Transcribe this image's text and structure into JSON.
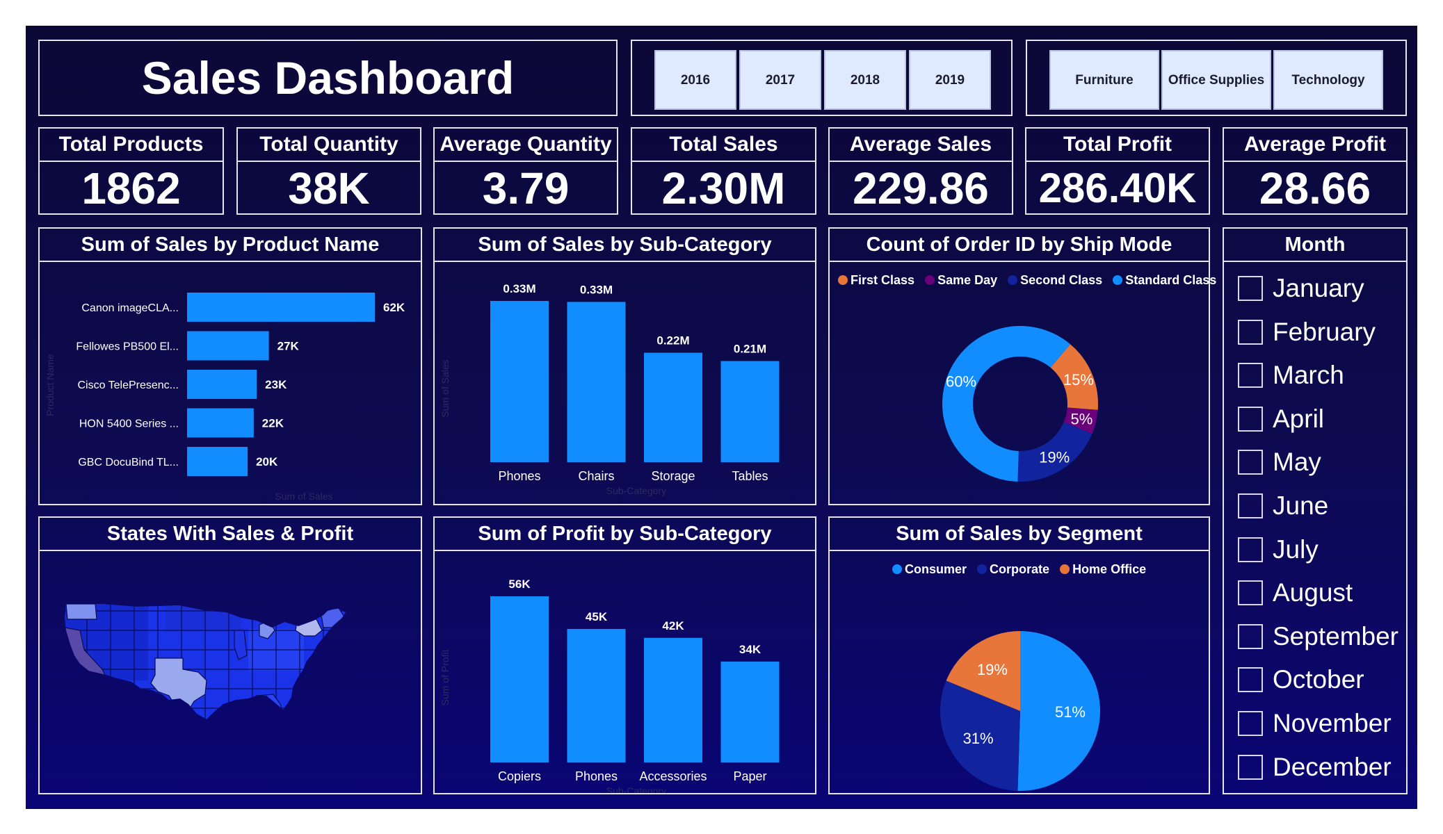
{
  "title": "Sales Dashboard",
  "year_slicer": [
    "2016",
    "2017",
    "2018",
    "2019"
  ],
  "category_slicer": [
    "Furniture",
    "Office Supplies",
    "Technology"
  ],
  "kpis": [
    {
      "label": "Total Products",
      "value": "1862"
    },
    {
      "label": "Total Quantity",
      "value": "38K"
    },
    {
      "label": "Average Quantity",
      "value": "3.79"
    },
    {
      "label": "Total Sales",
      "value": "2.30M"
    },
    {
      "label": "Average Sales",
      "value": "229.86"
    },
    {
      "label": "Total Profit",
      "value": "286.40K"
    },
    {
      "label": "Average Profit",
      "value": "28.66"
    }
  ],
  "month_slicer": {
    "title": "Month",
    "months": [
      "January",
      "February",
      "March",
      "April",
      "May",
      "June",
      "July",
      "August",
      "September",
      "October",
      "November",
      "December"
    ]
  },
  "map_panel": {
    "title": "States With Sales & Profit"
  },
  "colors": {
    "bar": "#118dff",
    "first_class": "#e8763a",
    "same_day": "#6b007b",
    "second_class": "#12239e",
    "standard_class": "#118dff",
    "consumer": "#118dff",
    "corporate": "#12239e",
    "home_office": "#e8763a"
  },
  "chart_data": [
    {
      "type": "bar",
      "orientation": "horizontal",
      "title": "Sum of Sales by Product Name",
      "xlabel": "Sum of Sales",
      "ylabel": "Product Name",
      "categories": [
        "Canon imageCLA...",
        "Fellowes PB500 El...",
        "Cisco TelePresenc...",
        "HON 5400 Series ...",
        "GBC DocuBind TL..."
      ],
      "values": [
        62000,
        27000,
        23000,
        22000,
        20000
      ],
      "data_labels": [
        "62K",
        "27K",
        "23K",
        "22K",
        "20K"
      ],
      "xlim": [
        0,
        62000
      ]
    },
    {
      "type": "bar",
      "title": "Sum of Sales by Sub-Category",
      "xlabel": "Sub-Category",
      "ylabel": "Sum of Sales",
      "categories": [
        "Phones",
        "Chairs",
        "Storage",
        "Tables"
      ],
      "values": [
        330000,
        328000,
        224000,
        207000
      ],
      "data_labels": [
        "0.33M",
        "0.33M",
        "0.22M",
        "0.21M"
      ],
      "ylim": [
        0,
        330000
      ]
    },
    {
      "type": "pie",
      "variant": "donut",
      "title": "Count of Order ID by Ship Mode",
      "legend_position": "top-left",
      "labels": [
        "First Class",
        "Same Day",
        "Second Class",
        "Standard Class"
      ],
      "values": [
        15,
        5,
        19,
        60
      ],
      "data_labels": [
        "15%",
        "5%",
        "19%",
        "60%"
      ]
    },
    {
      "type": "bar",
      "title": "Sum of Profit by Sub-Category",
      "xlabel": "Sub-Category",
      "ylabel": "Sum of Profit",
      "categories": [
        "Copiers",
        "Phones",
        "Accessories",
        "Paper"
      ],
      "values": [
        56000,
        45000,
        42000,
        34000
      ],
      "data_labels": [
        "56K",
        "45K",
        "42K",
        "34K"
      ],
      "ylim": [
        0,
        56000
      ]
    },
    {
      "type": "pie",
      "title": "Sum of Sales by Segment",
      "legend_position": "top-center",
      "labels": [
        "Consumer",
        "Corporate",
        "Home Office"
      ],
      "values": [
        51,
        31,
        19
      ],
      "data_labels": [
        "51%",
        "31%",
        "19%"
      ]
    }
  ]
}
